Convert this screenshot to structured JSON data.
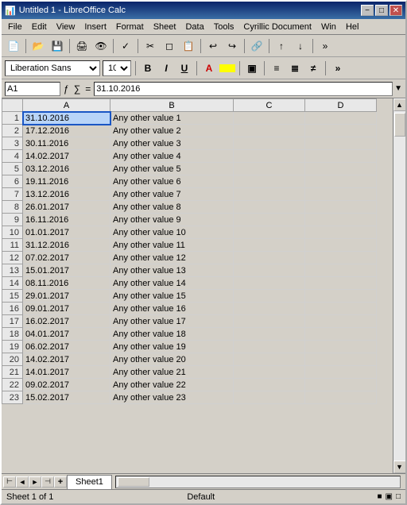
{
  "title": "Untitled 1 - LibreOffice Calc",
  "menu": {
    "items": [
      "File",
      "Edit",
      "View",
      "Insert",
      "Format",
      "Sheet",
      "Data",
      "Tools",
      "Cyrillic Document",
      "Win",
      "Hel"
    ]
  },
  "font": {
    "name": "Liberation Sans",
    "size": "10"
  },
  "formula_bar": {
    "cell_ref": "A1",
    "value": "31.10.2016"
  },
  "columns": [
    "",
    "A",
    "B",
    "C",
    "D"
  ],
  "rows": [
    {
      "num": 1,
      "a": "31.10.2016",
      "b": "Any other value 1"
    },
    {
      "num": 2,
      "a": "17.12.2016",
      "b": "Any other value 2"
    },
    {
      "num": 3,
      "a": "30.11.2016",
      "b": "Any other value 3"
    },
    {
      "num": 4,
      "a": "14.02.2017",
      "b": "Any other value 4"
    },
    {
      "num": 5,
      "a": "03.12.2016",
      "b": "Any other value 5"
    },
    {
      "num": 6,
      "a": "19.11.2016",
      "b": "Any other value 6"
    },
    {
      "num": 7,
      "a": "13.12.2016",
      "b": "Any other value 7"
    },
    {
      "num": 8,
      "a": "26.01.2017",
      "b": "Any other value 8"
    },
    {
      "num": 9,
      "a": "16.11.2016",
      "b": "Any other value 9"
    },
    {
      "num": 10,
      "a": "01.01.2017",
      "b": "Any other value 10"
    },
    {
      "num": 11,
      "a": "31.12.2016",
      "b": "Any other value 11"
    },
    {
      "num": 12,
      "a": "07.02.2017",
      "b": "Any other value 12"
    },
    {
      "num": 13,
      "a": "15.01.2017",
      "b": "Any other value 13"
    },
    {
      "num": 14,
      "a": "08.11.2016",
      "b": "Any other value 14"
    },
    {
      "num": 15,
      "a": "29.01.2017",
      "b": "Any other value 15"
    },
    {
      "num": 16,
      "a": "09.01.2017",
      "b": "Any other value 16"
    },
    {
      "num": 17,
      "a": "16.02.2017",
      "b": "Any other value 17"
    },
    {
      "num": 18,
      "a": "04.01.2017",
      "b": "Any other value 18"
    },
    {
      "num": 19,
      "a": "06.02.2017",
      "b": "Any other value 19"
    },
    {
      "num": 20,
      "a": "14.02.2017",
      "b": "Any other value 20"
    },
    {
      "num": 21,
      "a": "14.01.2017",
      "b": "Any other value 21"
    },
    {
      "num": 22,
      "a": "09.02.2017",
      "b": "Any other value 22"
    },
    {
      "num": 23,
      "a": "15.02.2017",
      "b": "Any other value 23"
    }
  ],
  "sheet_tab": "Sheet1",
  "status": {
    "text": "Sheet 1 of 1",
    "style": "Default"
  }
}
